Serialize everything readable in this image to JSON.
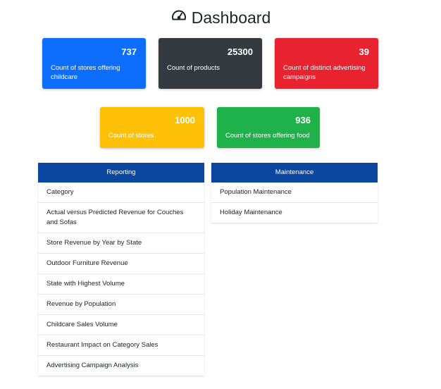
{
  "header": {
    "title": "Dashboard",
    "icon": "speedometer-icon"
  },
  "colors": {
    "blue": "#0d6efd",
    "dark": "#343a40",
    "red": "#e8232f",
    "yellow": "#ffc107",
    "green": "#20b24a",
    "panel_header": "#0b47a1"
  },
  "cards": [
    {
      "value": "737",
      "label": "Count of stores offering childcare"
    },
    {
      "value": "25300",
      "label": "Count of products"
    },
    {
      "value": "39",
      "label": "Count of distinct advertising campaigns"
    },
    {
      "value": "1000",
      "label": "Count of stores"
    },
    {
      "value": "936",
      "label": "Count of stores offering food"
    }
  ],
  "reporting": {
    "title": "Reporting",
    "items": [
      "Category",
      "Actual versus Predicted Revenue for Couches and Sofas",
      "Store Revenue by Year by State",
      "Outdoor Furniture Revenue",
      "State with Highest Volume",
      "Revenue by Population",
      "Childcare Sales Volume",
      "Restaurant Impact on Category Sales",
      "Advertising Campaign Analysis"
    ]
  },
  "maintenance": {
    "title": "Maintenance",
    "items": [
      "Population Maintenance",
      "Holiday Maintenance"
    ]
  }
}
